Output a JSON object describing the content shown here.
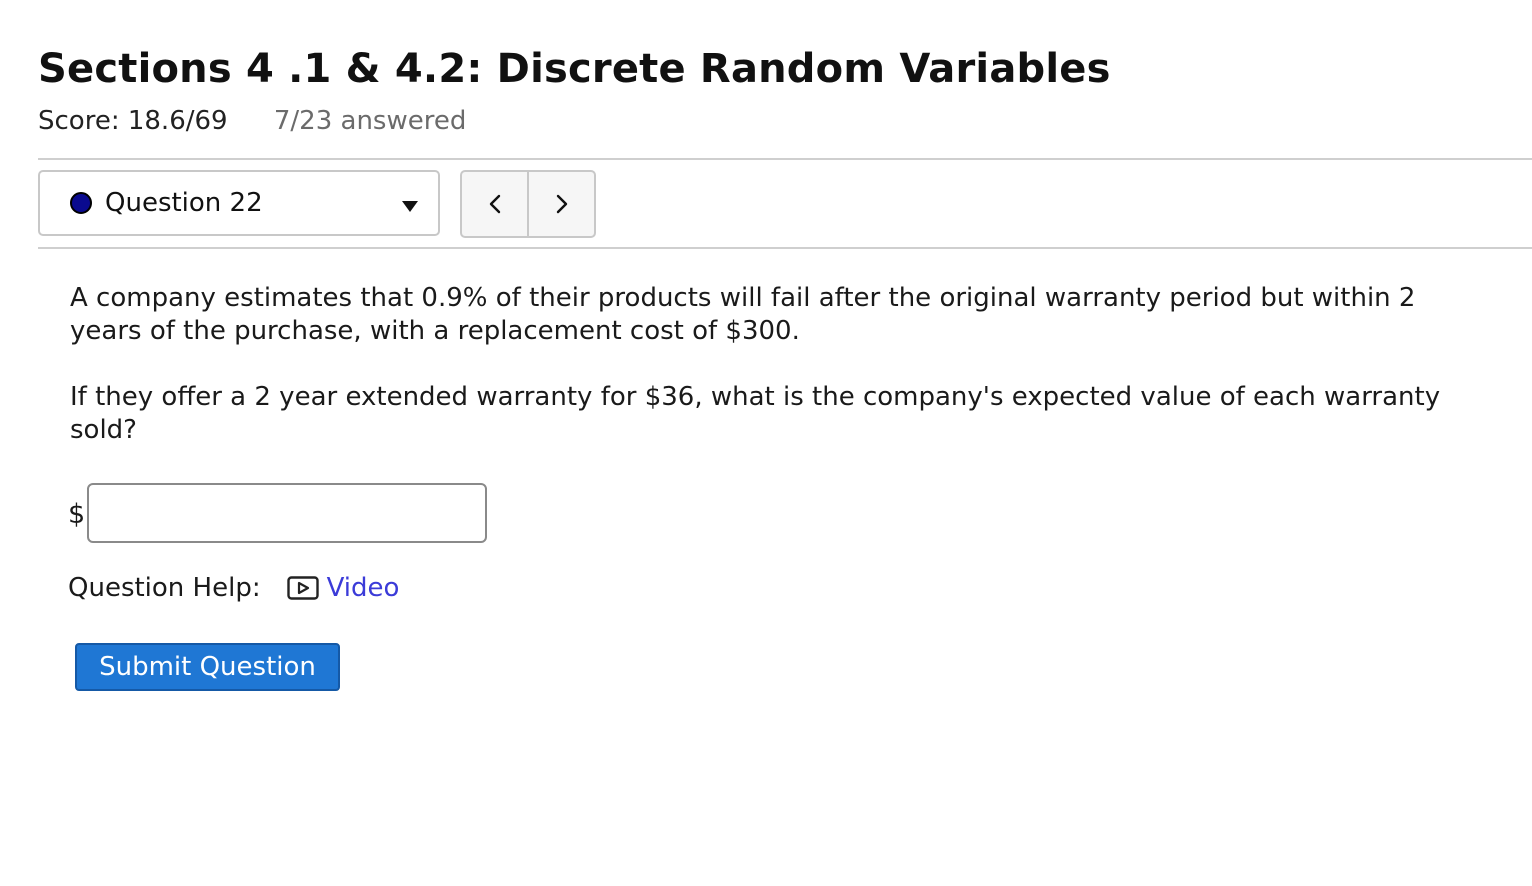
{
  "header": {
    "title": "Sections 4 .1 & 4.2: Discrete Random Variables",
    "score": "Score: 18.6/69",
    "answered": "7/23 answered"
  },
  "question_nav": {
    "selected": "Question 22",
    "status_color": "#0a0a8f",
    "prev_icon": "chevron-left-icon",
    "next_icon": "chevron-right-icon"
  },
  "question": {
    "paragraph_1": "A company estimates that 0.9% of their products will fail after the original warranty period but within 2 years of the purchase, with a replacement cost of $300.",
    "paragraph_2": "If they offer a 2 year extended warranty for $36, what is the company's expected value of each warranty sold?"
  },
  "answer": {
    "prefix": "$",
    "value": "",
    "placeholder": ""
  },
  "help": {
    "label": "Question Help:",
    "video_label": "Video",
    "video_icon": "play-video-icon"
  },
  "submit": {
    "label": "Submit Question",
    "color": "#1f77d4"
  }
}
